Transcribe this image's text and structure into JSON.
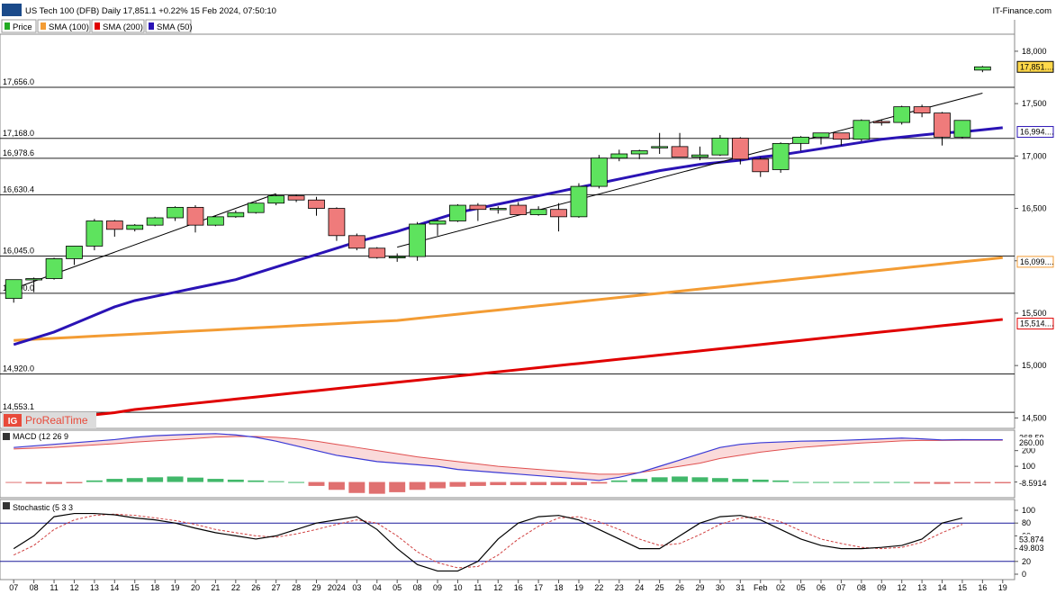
{
  "header": {
    "title": "US Tech 100 (DFB) Daily 17,851.1 +0.22% 15 Feb 2024, 07:50:10",
    "brand": "IT-Finance.com",
    "watermark": "ProRealTime",
    "watermark_logo": "IG"
  },
  "legend": [
    {
      "label": "Price",
      "color": "#22aa22",
      "icon": "candle-icon"
    },
    {
      "label": "SMA (100)",
      "color": "#f39c34",
      "icon": "square-icon"
    },
    {
      "label": "SMA (200)",
      "color": "#e00000",
      "icon": "square-icon"
    },
    {
      "label": "SMA (50)",
      "color": "#2a13b5",
      "icon": "square-icon"
    }
  ],
  "colors": {
    "up": "#5ee35e",
    "down": "#ef7b7b",
    "sma50": "#2a13b5",
    "sma100": "#f39c34",
    "sma200": "#e00000",
    "trend": "#000000",
    "last_price_bg": "#ffd84a",
    "macd": "#3a3ad6",
    "signal": "#e05050",
    "hist_up": "#41b86a",
    "hist_down": "#e07070",
    "stoch_k": "#000000",
    "stoch_d": "#d04040",
    "level_line": "#1a1a9a"
  },
  "chart_data": [
    {
      "type": "candlestick",
      "title": "US Tech 100 (DFB) Daily",
      "ylim": [
        14400,
        18300
      ],
      "y_axis_ticks": [
        "18,000",
        "17,500",
        "17,000",
        "16,500",
        "16,000",
        "15,500",
        "15,000",
        "14,500"
      ],
      "x_labels": [
        "07",
        "08",
        "11",
        "12",
        "13",
        "14",
        "15",
        "18",
        "19",
        "20",
        "21",
        "22",
        "26",
        "27",
        "28",
        "29",
        "2024",
        "03",
        "04",
        "05",
        "08",
        "09",
        "10",
        "11",
        "12",
        "16",
        "17",
        "18",
        "19",
        "22",
        "23",
        "24",
        "25",
        "26",
        "29",
        "30",
        "31",
        "Feb",
        "02",
        "05",
        "06",
        "07",
        "08",
        "09",
        "12",
        "13",
        "14",
        "15",
        "16",
        "19"
      ],
      "candles": [
        {
          "o": 15640,
          "h": 15820,
          "l": 15600,
          "c": 15820
        },
        {
          "o": 15820,
          "h": 15840,
          "l": 15700,
          "c": 15830
        },
        {
          "o": 15830,
          "h": 16030,
          "l": 15820,
          "c": 16020
        },
        {
          "o": 16020,
          "h": 16140,
          "l": 15960,
          "c": 16140
        },
        {
          "o": 16140,
          "h": 16400,
          "l": 16100,
          "c": 16380
        },
        {
          "o": 16380,
          "h": 16390,
          "l": 16230,
          "c": 16300
        },
        {
          "o": 16300,
          "h": 16350,
          "l": 16280,
          "c": 16340
        },
        {
          "o": 16340,
          "h": 16420,
          "l": 16330,
          "c": 16410
        },
        {
          "o": 16410,
          "h": 16520,
          "l": 16380,
          "c": 16510
        },
        {
          "o": 16510,
          "h": 16530,
          "l": 16270,
          "c": 16340
        },
        {
          "o": 16340,
          "h": 16430,
          "l": 16330,
          "c": 16420
        },
        {
          "o": 16420,
          "h": 16480,
          "l": 16410,
          "c": 16460
        },
        {
          "o": 16460,
          "h": 16560,
          "l": 16450,
          "c": 16550
        },
        {
          "o": 16550,
          "h": 16630,
          "l": 16530,
          "c": 16620
        },
        {
          "o": 16620,
          "h": 16630,
          "l": 16560,
          "c": 16580
        },
        {
          "o": 16580,
          "h": 16610,
          "l": 16430,
          "c": 16500
        },
        {
          "o": 16500,
          "h": 16510,
          "l": 16190,
          "c": 16240
        },
        {
          "o": 16240,
          "h": 16260,
          "l": 16100,
          "c": 16120
        },
        {
          "o": 16120,
          "h": 16130,
          "l": 16020,
          "c": 16030
        },
        {
          "o": 16030,
          "h": 16070,
          "l": 15990,
          "c": 16040
        },
        {
          "o": 16040,
          "h": 16370,
          "l": 16000,
          "c": 16350
        },
        {
          "o": 16350,
          "h": 16390,
          "l": 16240,
          "c": 16380
        },
        {
          "o": 16380,
          "h": 16540,
          "l": 16370,
          "c": 16530
        },
        {
          "o": 16530,
          "h": 16550,
          "l": 16380,
          "c": 16490
        },
        {
          "o": 16500,
          "h": 16520,
          "l": 16450,
          "c": 16500
        },
        {
          "o": 16530,
          "h": 16560,
          "l": 16450,
          "c": 16440
        },
        {
          "o": 16440,
          "h": 16520,
          "l": 16430,
          "c": 16490
        },
        {
          "o": 16490,
          "h": 16550,
          "l": 16280,
          "c": 16420
        },
        {
          "o": 16420,
          "h": 16740,
          "l": 16410,
          "c": 16710
        },
        {
          "o": 16710,
          "h": 17010,
          "l": 16690,
          "c": 16980
        },
        {
          "o": 16980,
          "h": 17060,
          "l": 16950,
          "c": 17020
        },
        {
          "o": 17020,
          "h": 17060,
          "l": 16970,
          "c": 17050
        },
        {
          "o": 17080,
          "h": 17220,
          "l": 17020,
          "c": 17090
        },
        {
          "o": 17090,
          "h": 17220,
          "l": 17000,
          "c": 16990
        },
        {
          "o": 16990,
          "h": 17090,
          "l": 16960,
          "c": 17010
        },
        {
          "o": 17010,
          "h": 17200,
          "l": 17000,
          "c": 17170
        },
        {
          "o": 17170,
          "h": 17180,
          "l": 16920,
          "c": 16970
        },
        {
          "o": 16970,
          "h": 16990,
          "l": 16800,
          "c": 16850
        },
        {
          "o": 16870,
          "h": 17130,
          "l": 16840,
          "c": 17120
        },
        {
          "o": 17120,
          "h": 17190,
          "l": 17050,
          "c": 17180
        },
        {
          "o": 17180,
          "h": 17220,
          "l": 17110,
          "c": 17220
        },
        {
          "o": 17220,
          "h": 17220,
          "l": 17100,
          "c": 17160
        },
        {
          "o": 17160,
          "h": 17350,
          "l": 17140,
          "c": 17340
        },
        {
          "o": 17330,
          "h": 17350,
          "l": 17290,
          "c": 17320
        },
        {
          "o": 17320,
          "h": 17480,
          "l": 17300,
          "c": 17470
        },
        {
          "o": 17470,
          "h": 17490,
          "l": 17370,
          "c": 17410
        },
        {
          "o": 17410,
          "h": 17420,
          "l": 17100,
          "c": 17180
        },
        {
          "o": 17180,
          "h": 17340,
          "l": 17170,
          "c": 17340
        },
        {
          "o": 17820,
          "h": 17860,
          "l": 17800,
          "c": 17851
        }
      ],
      "price_levels": [
        "17,656.0",
        "17,168.0",
        "16,978.6",
        "16,630.4",
        "16,045.0",
        "15,690.0",
        "14,920.0",
        "14,553.1"
      ],
      "last_price_label": "17,851....",
      "sma50_label": "16,994....",
      "sma100_label": "16,099....",
      "sma200_label": "15,514....",
      "sma50": [
        15200,
        15260,
        15320,
        15400,
        15480,
        15560,
        15620,
        15660,
        15700,
        15740,
        15780,
        15820,
        15880,
        15940,
        16000,
        16060,
        16120,
        16180,
        16230,
        16280,
        16340,
        16400,
        16460,
        16500,
        16540,
        16580,
        16620,
        16660,
        16700,
        16740,
        16780,
        16820,
        16860,
        16890,
        16920,
        16940,
        16960,
        16990,
        17010,
        17040,
        17070,
        17100,
        17130,
        17160,
        17180,
        17200,
        17220,
        17230,
        17250,
        17270
      ],
      "sma100": [
        15240,
        15250,
        15260,
        15270,
        15280,
        15290,
        15300,
        15310,
        15320,
        15330,
        15340,
        15350,
        15360,
        15370,
        15380,
        15390,
        15400,
        15410,
        15420,
        15430,
        15450,
        15470,
        15490,
        15510,
        15530,
        15550,
        15570,
        15590,
        15610,
        15630,
        15650,
        15670,
        15690,
        15710,
        15730,
        15750,
        15770,
        15790,
        15810,
        15830,
        15850,
        15870,
        15890,
        15910,
        15930,
        15950,
        15970,
        15990,
        16010,
        16030
      ],
      "sma200": [
        14460,
        14470,
        14490,
        14510,
        14530,
        14550,
        14580,
        14600,
        14620,
        14640,
        14660,
        14680,
        14700,
        14720,
        14740,
        14760,
        14780,
        14800,
        14820,
        14840,
        14860,
        14880,
        14900,
        14920,
        14940,
        14960,
        14980,
        15000,
        15020,
        15040,
        15060,
        15080,
        15100,
        15120,
        15140,
        15160,
        15180,
        15200,
        15220,
        15240,
        15260,
        15280,
        15300,
        15320,
        15340,
        15360,
        15380,
        15400,
        15420,
        15440
      ]
    },
    {
      "type": "line",
      "title": "MACD (12 26 9",
      "y_ticks": [
        "200",
        "100",
        "0"
      ],
      "labels": {
        "macd": "268.59",
        "signal": "260.00",
        "hist": "-8.5914"
      },
      "macd": [
        220,
        230,
        240,
        250,
        260,
        270,
        285,
        295,
        300,
        305,
        308,
        300,
        285,
        260,
        230,
        200,
        170,
        150,
        130,
        120,
        110,
        100,
        80,
        70,
        60,
        50,
        40,
        30,
        20,
        10,
        30,
        60,
        100,
        140,
        180,
        220,
        240,
        250,
        255,
        260,
        262,
        265,
        270,
        275,
        280,
        275,
        268,
        270,
        269,
        269
      ],
      "signal": [
        210,
        215,
        220,
        228,
        236,
        244,
        254,
        262,
        270,
        278,
        286,
        290,
        290,
        285,
        275,
        260,
        240,
        220,
        200,
        180,
        160,
        145,
        130,
        115,
        100,
        90,
        80,
        70,
        60,
        50,
        50,
        60,
        80,
        100,
        120,
        150,
        170,
        190,
        205,
        220,
        230,
        240,
        248,
        255,
        262,
        265,
        265,
        266,
        266,
        266
      ],
      "hist": [
        -5,
        -10,
        -12,
        -8,
        10,
        20,
        25,
        30,
        35,
        28,
        20,
        15,
        10,
        5,
        0,
        -25,
        -50,
        -70,
        -75,
        -65,
        -50,
        -40,
        -30,
        -25,
        -20,
        -20,
        -20,
        -20,
        -20,
        -10,
        10,
        20,
        30,
        35,
        30,
        25,
        20,
        15,
        10,
        0,
        0,
        0,
        0,
        0,
        0,
        -10,
        -12,
        -8,
        -8,
        -8
      ]
    },
    {
      "type": "line",
      "title": "Stochastic (5 3 3",
      "y_ticks": [
        "100",
        "80",
        "60",
        "40",
        "20",
        "0"
      ],
      "labels": {
        "d": "53.874",
        "k": "49.803"
      },
      "ylim": [
        0,
        100
      ],
      "k": [
        40,
        60,
        90,
        95,
        95,
        93,
        88,
        85,
        80,
        72,
        65,
        60,
        55,
        60,
        70,
        80,
        85,
        90,
        70,
        40,
        15,
        5,
        5,
        20,
        55,
        80,
        90,
        92,
        85,
        70,
        55,
        40,
        40,
        60,
        80,
        90,
        92,
        85,
        70,
        55,
        45,
        40,
        40,
        42,
        45,
        55,
        80,
        88,
        90,
        75,
        60,
        50
      ],
      "d": [
        30,
        45,
        70,
        85,
        92,
        94,
        92,
        88,
        84,
        78,
        70,
        65,
        60,
        58,
        63,
        70,
        78,
        85,
        80,
        60,
        35,
        18,
        10,
        12,
        30,
        55,
        75,
        88,
        90,
        82,
        70,
        55,
        45,
        48,
        62,
        78,
        88,
        90,
        82,
        68,
        55,
        48,
        42,
        40,
        42,
        50,
        65,
        78,
        88,
        85,
        72,
        54
      ]
    }
  ]
}
